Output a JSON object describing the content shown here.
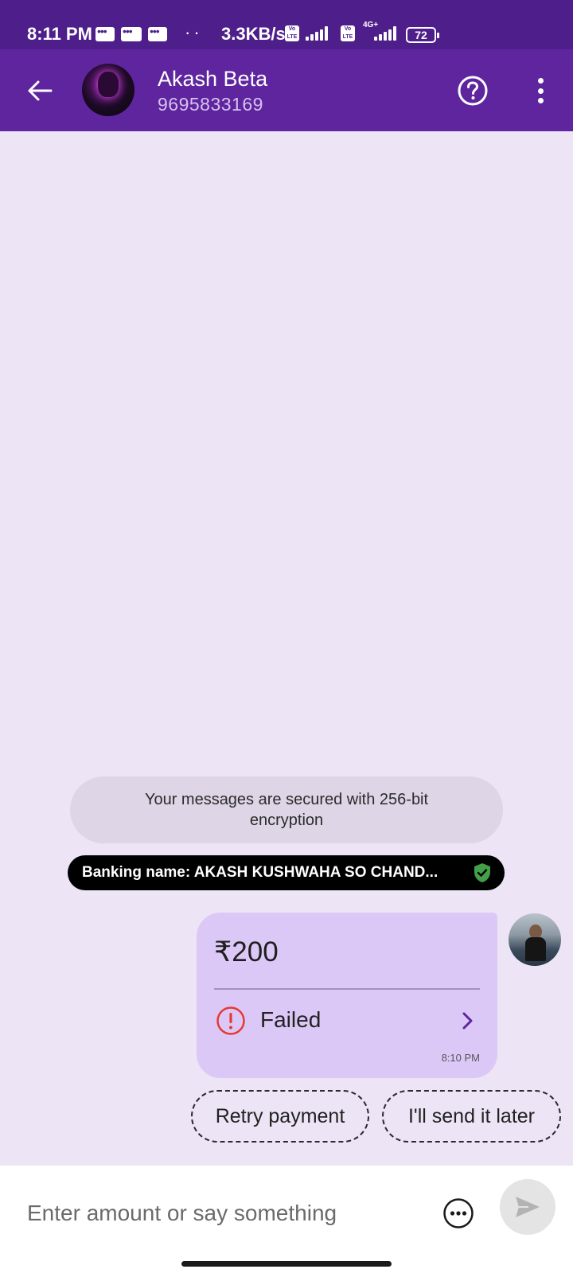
{
  "status_bar": {
    "time": "8:11 PM",
    "network_speed": "3.3KB/s",
    "network_type": "4G+",
    "battery": "72"
  },
  "header": {
    "contact_name": "Akash Beta",
    "contact_phone": "9695833169",
    "back_icon": "arrow-left-icon",
    "help_icon": "help-circle-icon",
    "menu_icon": "more-vertical-icon"
  },
  "chat": {
    "encryption_notice": "Your messages are secured with 256-bit encryption",
    "banking_name": "Banking name: AKASH KUSHWAHA SO CHAND...",
    "payment": {
      "amount": "₹200",
      "status": "Failed",
      "time": "8:10 PM",
      "status_color": "#e53935"
    },
    "quick_replies": [
      "Retry payment",
      "I'll send it later"
    ]
  },
  "composer": {
    "placeholder": "Enter amount or say something"
  },
  "colors": {
    "brand": "#5f259f",
    "status_bar": "#4e1f8a",
    "chat_background": "#ede4f6",
    "bubble": "#dcc8f7",
    "verified": "#43a047"
  }
}
